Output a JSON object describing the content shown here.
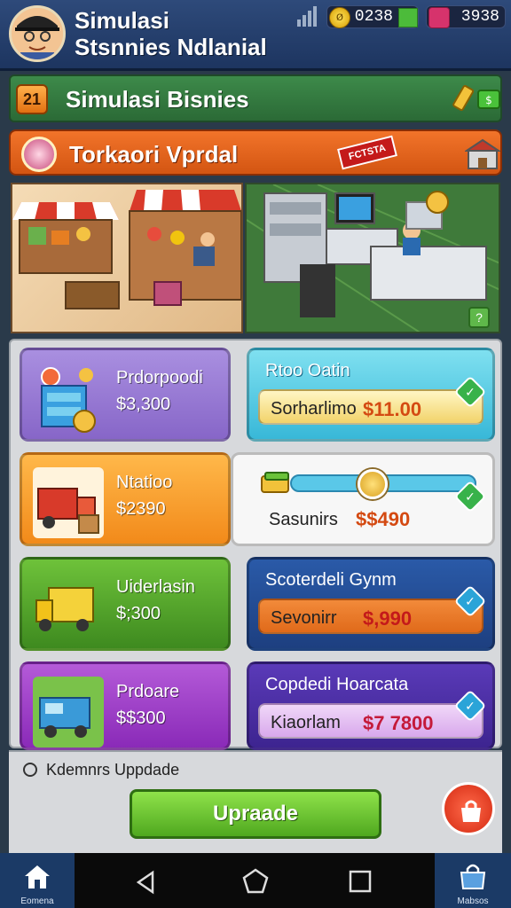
{
  "header": {
    "title_line1": "Simulasi",
    "title_line2": "Stsnnies Ndlanial",
    "coins": "0238",
    "coin_symbol": "ø",
    "gems": "3938"
  },
  "level": {
    "number": "21",
    "title": "Simulasi Bisnies"
  },
  "banner": {
    "title": "Torkaori Vprdal",
    "sign_text": "FCTSTA"
  },
  "scene": {
    "info_glyph": "?"
  },
  "products": [
    {
      "name": "Prdorpoodi",
      "price": "$3,300",
      "icon": "store-shelf-icon"
    },
    {
      "name": "Ntatioo",
      "price": "$2390",
      "icon": "red-truck-icon"
    },
    {
      "name": "Uiderlasin",
      "price": "$;300",
      "icon": "yellow-truck-icon"
    },
    {
      "name": "Prdoare",
      "price": "$$300",
      "icon": "blue-van-icon"
    }
  ],
  "stats": [
    {
      "title": "Rtoo Oatin",
      "label": "Sorharlimo",
      "amount": "$11.00"
    },
    {
      "title": "",
      "label": "Sasunirs",
      "amount": "$$490"
    },
    {
      "title": "Scoterdeli Gynm",
      "label": "Sevonirr",
      "amount": "$,990"
    },
    {
      "title": "Copdedi Hoarcata",
      "label": "Kiaorlam",
      "amount": "$7 7800"
    }
  ],
  "upgrade": {
    "label": "Kdemnrs Uppdade",
    "button": "Upraade"
  },
  "navbar": {
    "home_label": "Eomena",
    "shop_label": "Mabsos"
  }
}
